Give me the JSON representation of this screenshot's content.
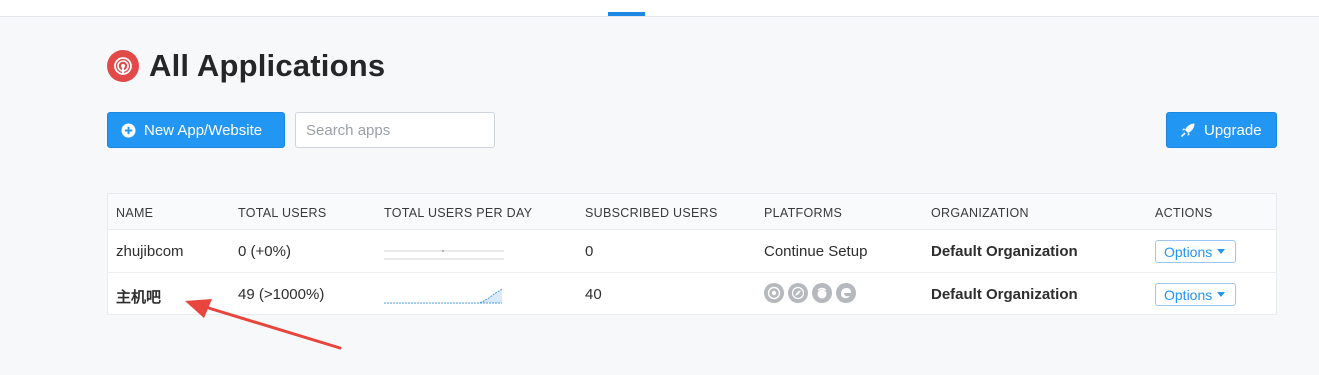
{
  "header": {
    "title": "All Applications"
  },
  "toolbar": {
    "new_app_label": "New App/Website",
    "search_placeholder": "Search apps",
    "upgrade_label": "Upgrade"
  },
  "table": {
    "columns": [
      "NAME",
      "TOTAL USERS",
      "TOTAL USERS PER DAY",
      "SUBSCRIBED USERS",
      "PLATFORMS",
      "ORGANIZATION",
      "ACTIONS"
    ],
    "rows": [
      {
        "name": "zhujibcom",
        "total_users": "0  (+0%)",
        "subscribed_users": "0",
        "platforms": "Continue Setup",
        "organization": "Default Organization",
        "action_label": "Options"
      },
      {
        "name": "主机吧",
        "total_users": "49  (>1000%)",
        "subscribed_users": "40",
        "platform_icons": [
          "chrome-icon",
          "safari-icon",
          "firefox-icon",
          "edge-icon"
        ],
        "organization": "Default Organization",
        "action_label": "Options"
      }
    ]
  },
  "colors": {
    "primary": "#2196f3",
    "logo": "#e24a4a",
    "annotation_arrow": "#e8453c"
  }
}
